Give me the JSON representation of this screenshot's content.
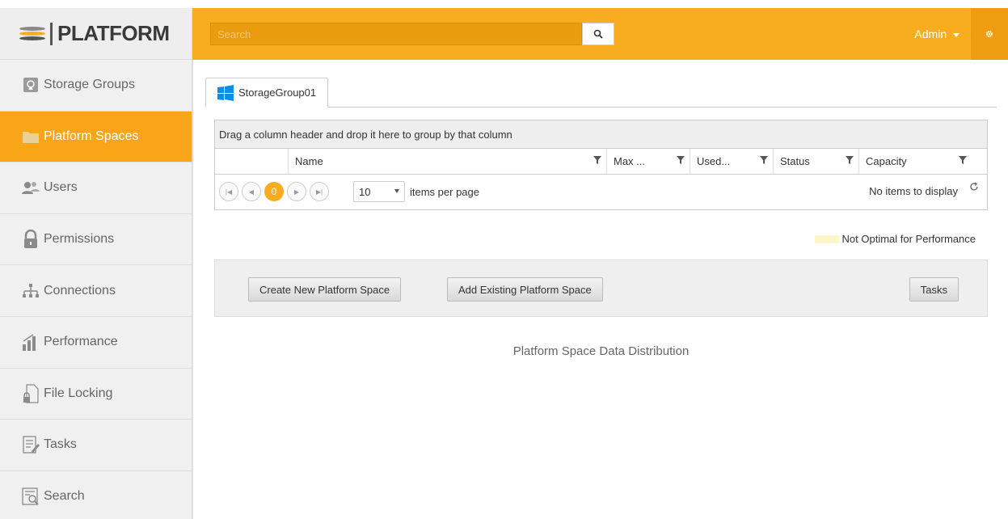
{
  "app": {
    "logo_text": "PLATFORM"
  },
  "colors": {
    "accent": "#f8ac1f",
    "sidebar_bg": "#f0f0f0",
    "legend_swatch": "#fdf6c8"
  },
  "sidebar": {
    "items": [
      {
        "label": "Storage Groups",
        "icon": "storage-groups-icon",
        "active": false
      },
      {
        "label": "Platform Spaces",
        "icon": "folder-icon",
        "active": true
      },
      {
        "label": "Users",
        "icon": "users-icon",
        "active": false
      },
      {
        "label": "Permissions",
        "icon": "lock-icon",
        "active": false
      },
      {
        "label": "Connections",
        "icon": "network-icon",
        "active": false
      },
      {
        "label": "Performance",
        "icon": "bar-chart-icon",
        "active": false
      },
      {
        "label": "File Locking",
        "icon": "file-lock-icon",
        "active": false
      },
      {
        "label": "Tasks",
        "icon": "tasks-icon",
        "active": false
      },
      {
        "label": "Search",
        "icon": "search-list-icon",
        "active": false
      }
    ]
  },
  "topbar": {
    "search_placeholder": "Search",
    "user_label": "Admin"
  },
  "main": {
    "tab_label": "StorageGroup01",
    "grid": {
      "group_hint": "Drag a column header and drop it here to group by that column",
      "columns": [
        "Name",
        "Max ...",
        "Used...",
        "Status",
        "Capacity"
      ],
      "pager": {
        "current_page": "0",
        "page_size": "10",
        "items_per_page_label": "items per page",
        "empty_message": "No items to display"
      }
    },
    "legend_label": "Not Optimal for Performance",
    "buttons": {
      "create": "Create New Platform Space",
      "add_existing": "Add Existing Platform Space",
      "tasks": "Tasks"
    },
    "distribution_title": "Platform Space Data Distribution"
  }
}
